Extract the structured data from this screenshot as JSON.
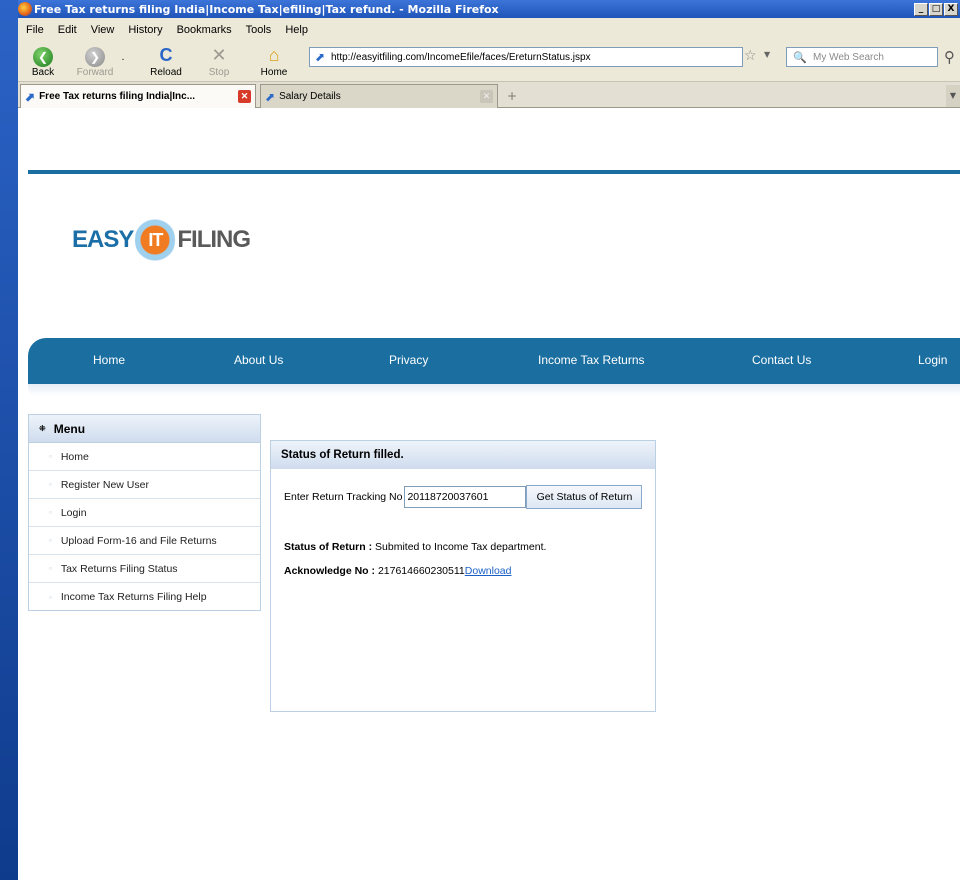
{
  "window": {
    "title": "Free Tax returns filing India|Income Tax|efiling|Tax refund. - Mozilla Firefox",
    "controls": [
      "_",
      "□",
      "X"
    ]
  },
  "menubar": {
    "items": [
      "File",
      "Edit",
      "View",
      "History",
      "Bookmarks",
      "Tools",
      "Help"
    ]
  },
  "toolbar": {
    "back": "Back",
    "forward": "Forward",
    "reload": "Reload",
    "stop": "Stop",
    "home": "Home",
    "url": "http://easyitfiling.com/IncomeEfile/faces/EreturnStatus.jspx",
    "search_placeholder": "My Web Search"
  },
  "tabs": [
    {
      "label": "Free Tax returns filing India|Inc...",
      "active": true
    },
    {
      "label": "Salary Details",
      "active": false
    }
  ],
  "site": {
    "logo": {
      "left": "EASY",
      "mid": "IT",
      "right": "FILING"
    },
    "nav": [
      "Home",
      "About Us",
      "Privacy",
      "Income Tax Returns",
      "Contact Us",
      "Login"
    ]
  },
  "sidebar": {
    "title": "Menu",
    "items": [
      "Home",
      "Register New User",
      "Login",
      "Upload Form-16 and File Returns",
      "Tax Returns Filing Status",
      "Income Tax Returns Filing Help"
    ]
  },
  "panel": {
    "title": "Status of Return filled.",
    "tracking_label": "Enter Return Tracking No",
    "tracking_value": "20118720037601",
    "button": "Get Status of Return",
    "status_label": "Status of Return :",
    "status_value": "Submited to Income Tax department.",
    "ack_label": "Acknowledge No :",
    "ack_value": "217614660230511",
    "download": "Download"
  }
}
